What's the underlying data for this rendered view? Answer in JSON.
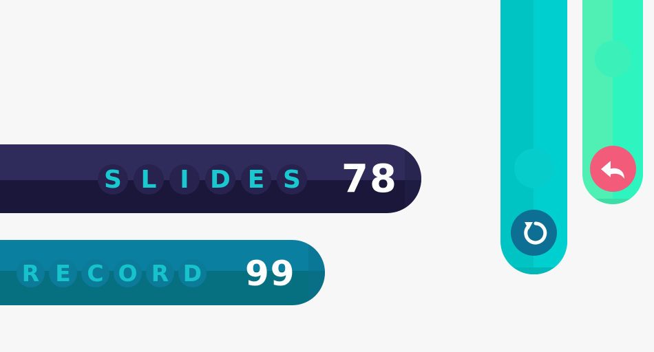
{
  "slides": {
    "label_letters": [
      "S",
      "L",
      "I",
      "D",
      "E",
      "S"
    ],
    "value": "78"
  },
  "record": {
    "label_letters": [
      "R",
      "E",
      "C",
      "O",
      "R",
      "D"
    ],
    "value": "99"
  },
  "buttons": {
    "restart_icon": "restart-icon",
    "undo_icon": "undo-icon"
  },
  "colors": {
    "slides_panel": "#2f2b5a",
    "record_panel": "#0a7fa0",
    "label_text": "#19c9cf",
    "teal_column": "#00c4c4",
    "green_column": "#50f0b4",
    "restart_button": "#0d6f93",
    "undo_button": "#f25c7a"
  }
}
